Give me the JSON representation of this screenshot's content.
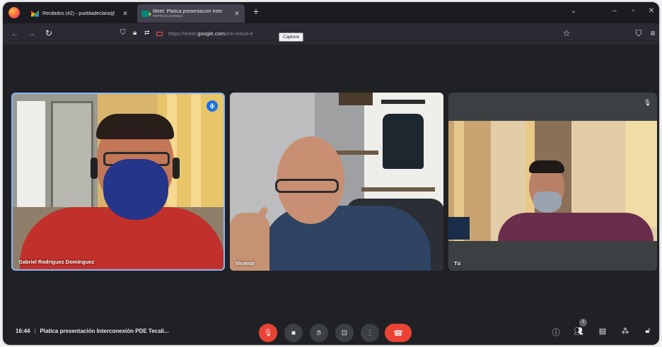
{
  "browser": {
    "tabs": [
      {
        "title": "Recibidos (42) - puebladeclara@",
        "subtitle": "",
        "active": false
      },
      {
        "title": "Meet: Platica presentación Inter",
        "subtitle": "REPRODUCIENDO",
        "active": true
      }
    ],
    "url_prefix": "https://meet.",
    "url_domain": "google.com",
    "url_path": "/crk-nmus-e",
    "tooltip": "Capture"
  },
  "participants": [
    {
      "name": "Gabriel Rodríguez Domínguez",
      "state": "speaking"
    },
    {
      "name": "Vicente",
      "state": "normal"
    },
    {
      "name": "Tú",
      "state": "muted"
    }
  ],
  "meeting": {
    "time": "16:44",
    "separator": "|",
    "title": "Platica presentación Interconexión PDE Tecali..."
  },
  "toolbar": {
    "participants_count": "3"
  },
  "colors": {
    "meet_background": "#202124",
    "control_gray": "#3c4043",
    "danger_red": "#ea4335",
    "speaking_blue": "#1a73e8"
  }
}
